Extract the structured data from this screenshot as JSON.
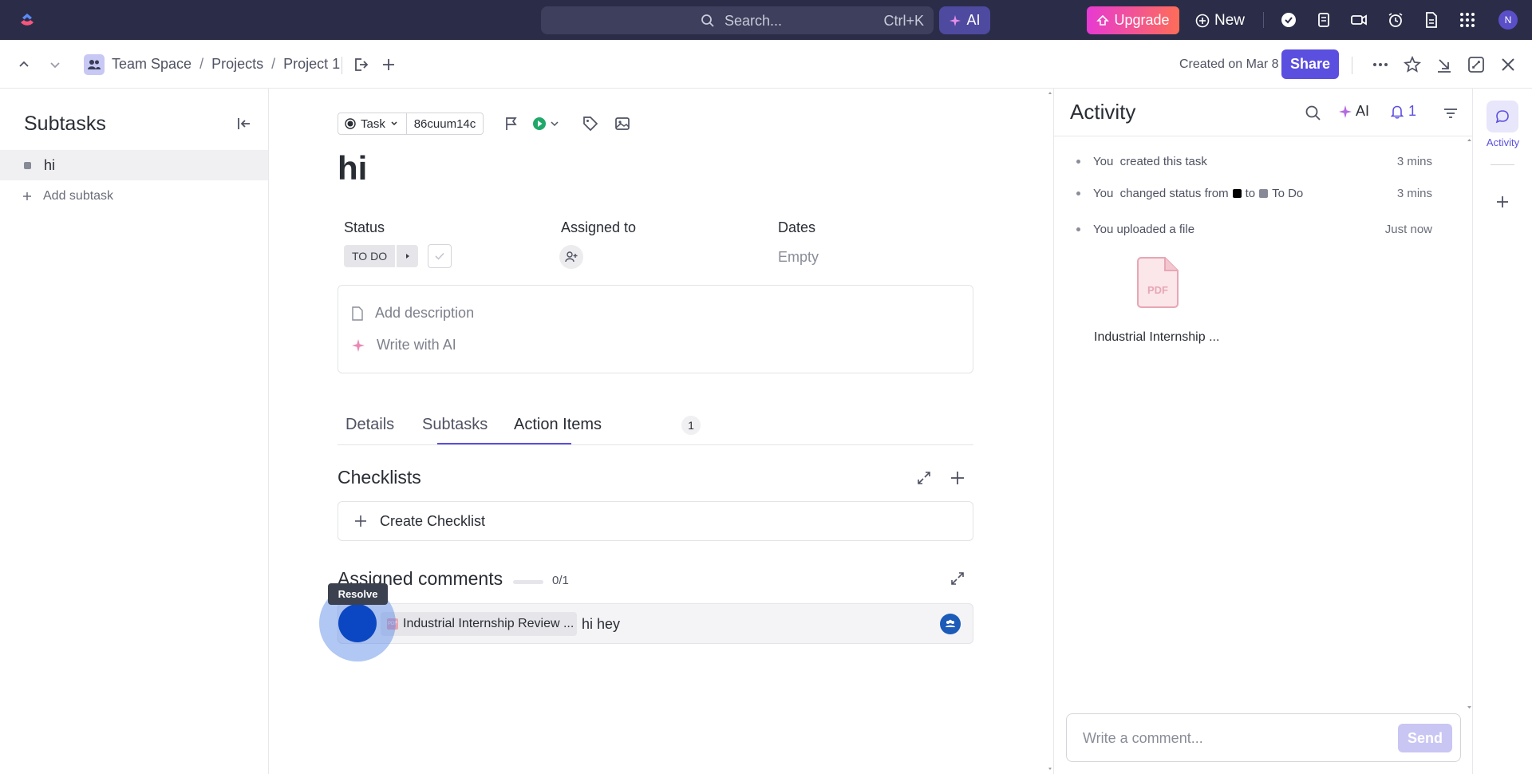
{
  "topbar": {
    "search_placeholder": "Search...",
    "search_shortcut": "Ctrl+K",
    "ai_label": "AI",
    "upgrade_label": "Upgrade",
    "new_label": "New",
    "avatar_initial": "N"
  },
  "header": {
    "breadcrumb": [
      "Team Space",
      "Projects",
      "Project 1"
    ],
    "separator": "/",
    "created_text": "Created on Mar 8",
    "share_label": "Share"
  },
  "sidebar": {
    "title": "Subtasks",
    "items": [
      {
        "label": "hi"
      }
    ],
    "add_label": "Add subtask"
  },
  "task": {
    "type_label": "Task",
    "id": "86cuum14c",
    "title": "hi",
    "status_label": "Status",
    "status_value": "TO DO",
    "assigned_label": "Assigned to",
    "dates_label": "Dates",
    "dates_value": "Empty",
    "add_description": "Add description",
    "write_ai": "Write with AI",
    "tabs": [
      {
        "label": "Details"
      },
      {
        "label": "Subtasks"
      },
      {
        "label": "Action Items",
        "badge": "1"
      }
    ],
    "checklists_title": "Checklists",
    "create_checklist": "Create Checklist",
    "assigned_comments_title": "Assigned comments",
    "assigned_progress": "0/1",
    "tooltip": "Resolve",
    "comment": {
      "file_name": "Industrial Internship Review ...",
      "text": "hi hey"
    }
  },
  "activity": {
    "title": "Activity",
    "ai_label": "AI",
    "bell_count": "1",
    "items": [
      {
        "actor": "You",
        "text": "created this task",
        "time": "3 mins"
      },
      {
        "actor": "You",
        "text": "changed status from",
        "to_word": "to",
        "to_status": "To Do",
        "time": "3 mins"
      },
      {
        "actor": "You",
        "text": "uploaded a file",
        "time": "Just now"
      }
    ],
    "file_label": "PDF",
    "file_name": "Industrial Internship ...",
    "comment_placeholder": "Write a comment...",
    "send_label": "Send"
  },
  "rail": {
    "activity_label": "Activity"
  },
  "colors": {
    "accent": "#5b4fe0",
    "topbar": "#2b2d48",
    "resolve_blue": "#0b47c2"
  }
}
